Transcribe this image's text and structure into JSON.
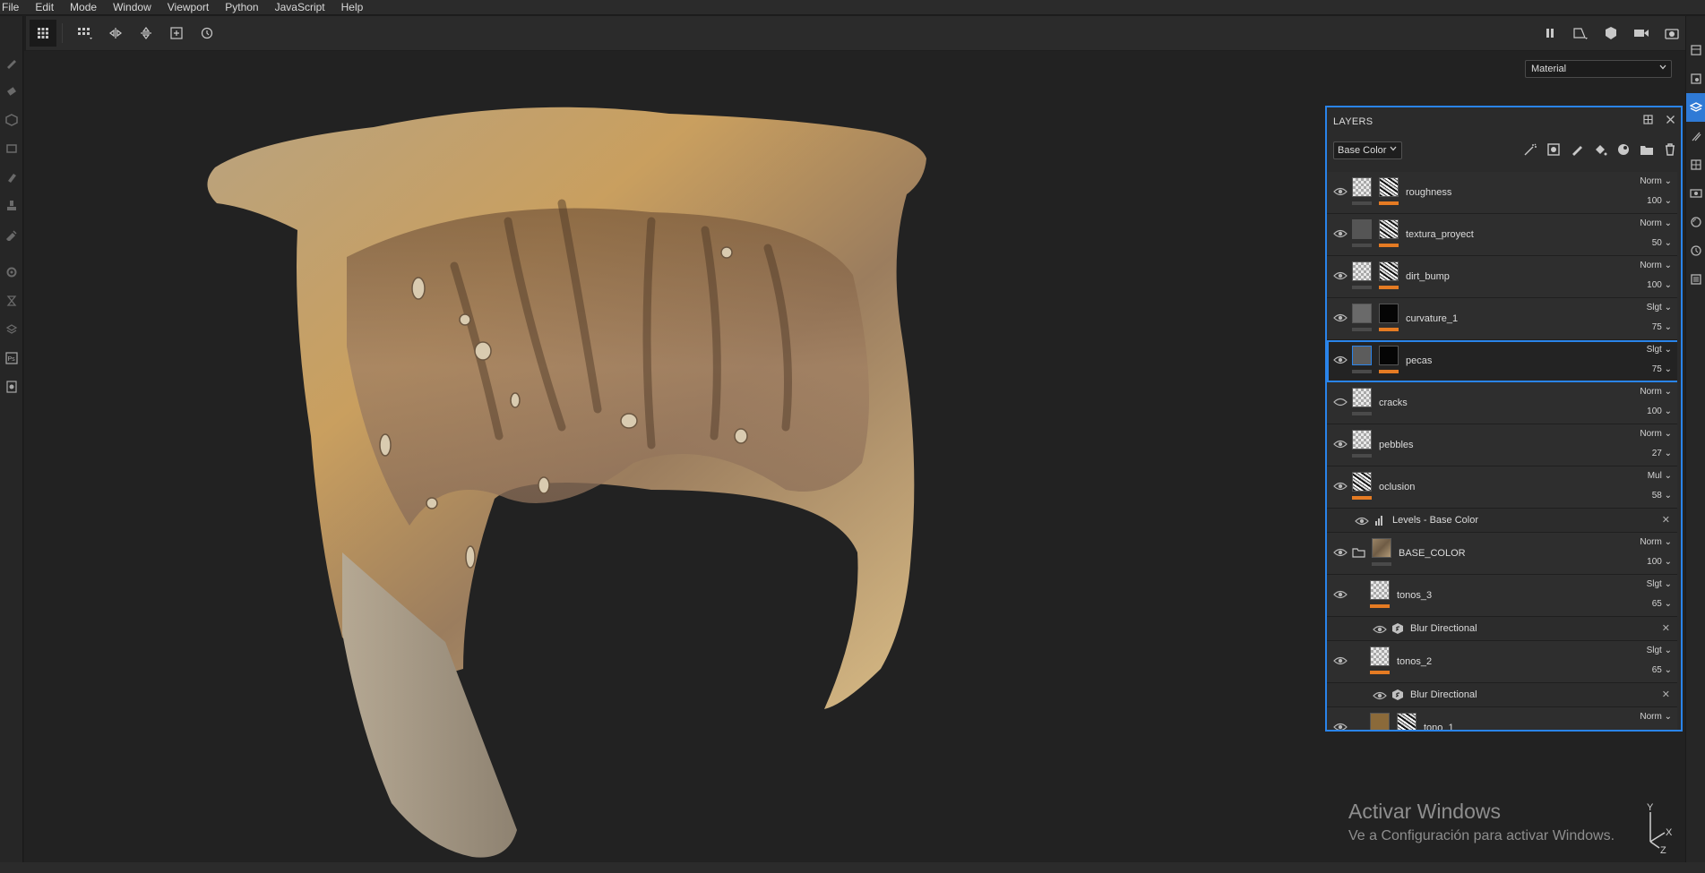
{
  "menu": [
    "File",
    "Edit",
    "Mode",
    "Window",
    "Viewport",
    "Python",
    "JavaScript",
    "Help"
  ],
  "viewport": {
    "material_select": "Material"
  },
  "watermark": {
    "line1": "Activar Windows",
    "line2": "Ve a Configuración para activar Windows."
  },
  "gizmo": {
    "x": "X",
    "y": "Y",
    "z": "Z"
  },
  "layers_panel": {
    "title": "LAYERS",
    "channel": "Base Color",
    "rows": [
      {
        "name": "roughness",
        "blend": "Norm",
        "opacity": "100"
      },
      {
        "name": "textura_proyect",
        "blend": "Norm",
        "opacity": "50"
      },
      {
        "name": "dirt_bump",
        "blend": "Norm",
        "opacity": "100"
      },
      {
        "name": "curvature_1",
        "blend": "Slgt",
        "opacity": "75"
      },
      {
        "name": "pecas",
        "blend": "Slgt",
        "opacity": "75"
      },
      {
        "name": "cracks",
        "blend": "Norm",
        "opacity": "100"
      },
      {
        "name": "pebbles",
        "blend": "Norm",
        "opacity": "27"
      },
      {
        "name": "oclusion",
        "blend": "Mul",
        "opacity": "58"
      },
      {
        "name": "Levels - Base Color"
      },
      {
        "name": "BASE_COLOR",
        "blend": "Norm",
        "opacity": "100"
      },
      {
        "name": "tonos_3",
        "blend": "Slgt",
        "opacity": "65"
      },
      {
        "name": "Blur Directional"
      },
      {
        "name": "tonos_2",
        "blend": "Slgt",
        "opacity": "65"
      },
      {
        "name": "Blur Directional"
      },
      {
        "name": "tono_1",
        "blend": "Norm"
      }
    ]
  },
  "colors": {
    "accent": "#2a84ea",
    "opacity_bar": "#e57b23"
  }
}
